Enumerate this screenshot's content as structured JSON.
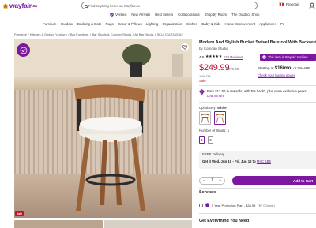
{
  "header": {
    "logo_text": "wayfair",
    "logo_tld": ".ca",
    "search_placeholder": "Find anything home on Wayfair.ca",
    "language": "Français",
    "brand_color": "#7b189f",
    "sale_color": "#c8102e"
  },
  "secondary_nav": {
    "items": [
      "Verified",
      "New Arrivals",
      "Best Sellers",
      "Collaborations",
      "Shop by Room",
      "The Outdoor Shop"
    ]
  },
  "categories": [
    "Furniture",
    "Outdoor",
    "Bedding & Bath",
    "Rugs",
    "Decor & Pillows",
    "Lighting",
    "Organization",
    "Kitchen",
    "Baby & Kids",
    "Home Improvement",
    "Appliances",
    "Pe"
  ],
  "breadcrumb": [
    "Furniture",
    "/",
    "Kitchen & Dining Furniture",
    "/",
    "Bar Furniture",
    "/",
    "Bar Stools & Counter Stools",
    "/",
    "All Bar Stools",
    "/",
    "SKU: C112333762"
  ],
  "gallery": {
    "sale_badge": "Sale"
  },
  "product": {
    "title": "Modern And Stylish Bucket Swivel Barstool With Backrest",
    "brand": "by Corrigan Studio",
    "rating_value": "4.8",
    "stars": "★★★★★",
    "rating": 4.8,
    "reviews": "124 Reviews",
    "verified_badge": "This item is Wayfair Verified",
    "price": "$249.99",
    "old_price": "$279.99",
    "percent_off": "11% Off",
    "sale_label": "Sale",
    "financing_prefix": "Starting at ",
    "financing_amount": "$16/mo.",
    "financing_suffix": " or 0% APR",
    "financing_link": "Check your buying power",
    "rewards_text": "Earn $12.50 in rewards, with 5% back*, plus more exclusive perks.",
    "rewards_link": "Learn more",
    "upholstery_label": "Upholstery:",
    "upholstery_value": "White",
    "number_of_stools_label": "Number of Stools:",
    "number_of_stools_value": "1",
    "stool_options": [
      "1",
      "2"
    ],
    "delivery_title": "FREE Delivery",
    "delivery_window": "Get it Wed, Jun 10 - Fri, Jun 12 to ",
    "delivery_postal": "M4C 1B5",
    "quantity": "1",
    "add_to_cart": "Add to Cart"
  },
  "services": {
    "title": "Services",
    "protection_plan": "5 Year Protection Plan - $34.99",
    "protection_unit": " ($7.00/year)"
  },
  "get_everything": {
    "title": "Get Everything You Need"
  }
}
